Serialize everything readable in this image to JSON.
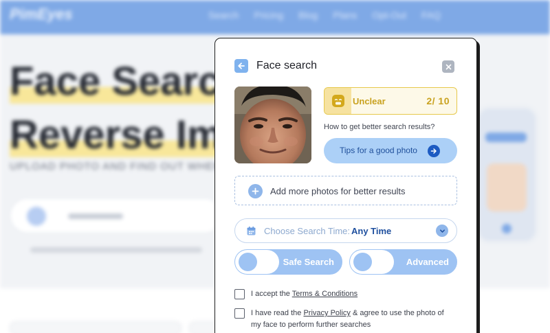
{
  "background": {
    "logo": "PimEyes",
    "nav": [
      "Search",
      "Pricing",
      "Blog",
      "Plans",
      "Opt-Out",
      "FAQ"
    ],
    "hero_title_line1": "Face Search",
    "hero_title_line2": "Reverse Image",
    "hero_subtitle": "UPLOAD PHOTO AND FIND OUT WHERE"
  },
  "modal": {
    "title": "Face search",
    "status": {
      "label": "Unclear",
      "score": "2/ 10"
    },
    "hint": "How to get better search results?",
    "tips_button": "Tips for a good photo",
    "add_more": "Add more photos for better results",
    "search_time": {
      "label": "Choose Search Time:",
      "value": "Any Time"
    },
    "toggles": {
      "safe_search": "Safe Search",
      "advanced": "Advanced"
    },
    "checks": {
      "terms_prefix": "I accept the ",
      "terms_link": "Terms & Conditions",
      "privacy_prefix": "I have read the ",
      "privacy_link": "Privacy Policy",
      "privacy_suffix": " & agree to use the photo of my face to perform further searches"
    }
  },
  "colors": {
    "accent": "#7fb2ee",
    "status_yellow": "#c9a21f",
    "primary_dark": "#1e4f9e"
  }
}
